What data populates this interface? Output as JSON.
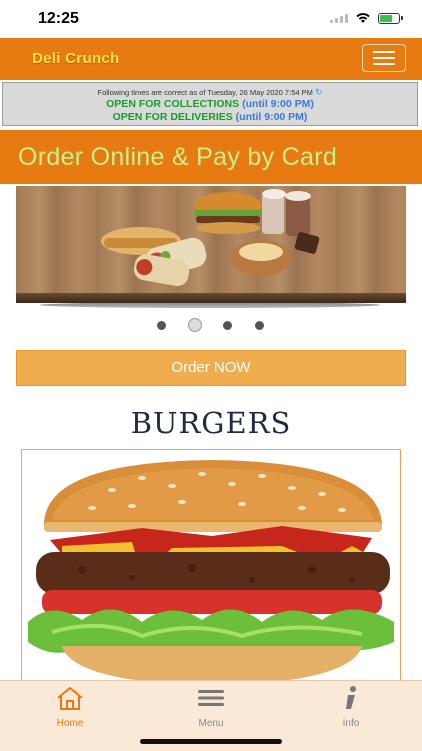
{
  "status_bar": {
    "time": "12:25"
  },
  "header": {
    "brand": "Deli Crunch",
    "menu_icon": "hamburger-icon"
  },
  "notice": {
    "info_line": "Following times are correct as of Tuesday, 26 May 2020 7:54 PM",
    "refresh_icon": "refresh-icon",
    "collections_label": "OPEN FOR COLLECTIONS",
    "collections_until": "(until 9:00 PM)",
    "deliveries_label": "OPEN FOR DELIVERIES",
    "deliveries_until": "(until 9:00 PM)"
  },
  "promo": {
    "text": "Order Online & Pay by Card"
  },
  "carousel": {
    "slide_count": 4,
    "active_index": 1
  },
  "order_button": {
    "label": "Order NOW"
  },
  "section": {
    "title": "BURGERS"
  },
  "tabbar": {
    "items": [
      {
        "label": "Home",
        "icon": "home-icon",
        "active": true
      },
      {
        "label": "Menu",
        "icon": "menu-icon",
        "active": false
      },
      {
        "label": "Info",
        "icon": "info-icon",
        "active": false
      }
    ]
  },
  "colors": {
    "accent": "#e87a12",
    "brand_text": "#ffe14a",
    "promo_text": "#c8f089",
    "open_green": "#1a9c2a",
    "button": "#f0ad4e"
  }
}
